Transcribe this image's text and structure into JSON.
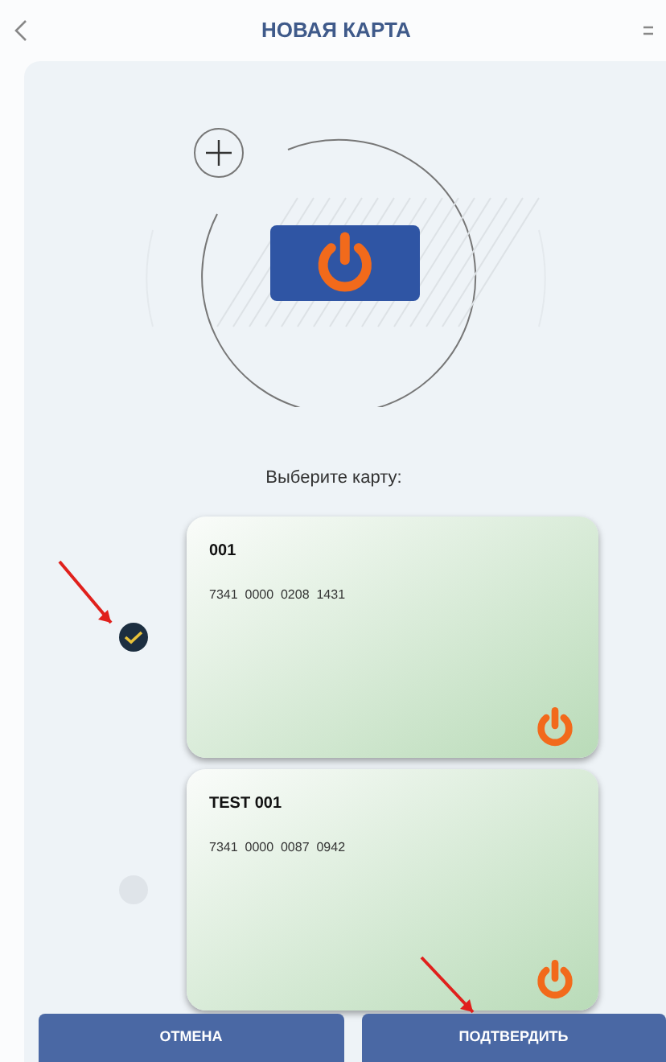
{
  "header": {
    "title": "НОВАЯ КАРТА"
  },
  "prompt": "Выберите карту:",
  "cards": [
    {
      "name": "001",
      "number": "7341  0000  0208  1431",
      "selected": true
    },
    {
      "name": "TEST 001",
      "number": "7341  0000  0087  0942",
      "selected": false
    }
  ],
  "buttons": [
    {
      "label": "ОТМЕНА"
    },
    {
      "label": "ПОДТВЕРДИТЬ"
    }
  ]
}
